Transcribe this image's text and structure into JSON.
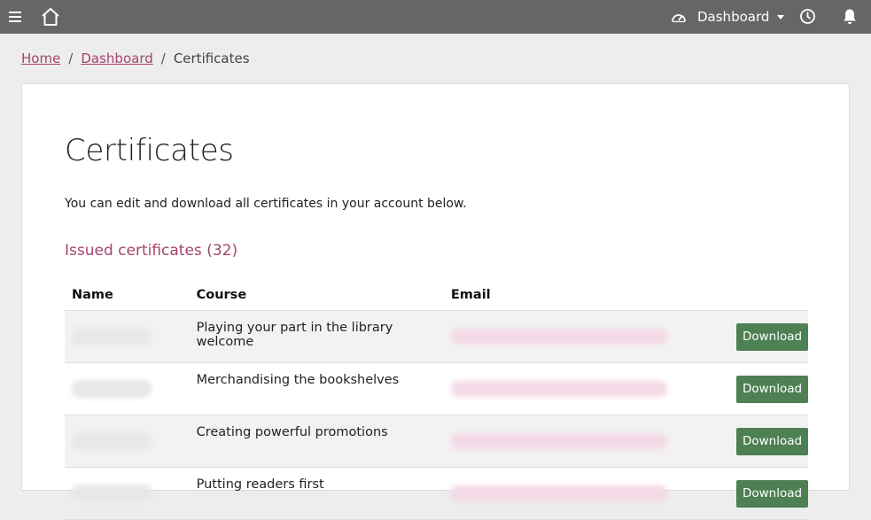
{
  "topbar": {
    "menu_label": "Dashboard",
    "icons": [
      "hamburger-icon",
      "home-icon",
      "speedometer-icon",
      "caret-down-icon",
      "clock-icon",
      "bell-icon"
    ]
  },
  "breadcrumb": {
    "home": "Home",
    "dashboard": "Dashboard",
    "current": "Certificates",
    "separator": "/"
  },
  "page": {
    "title": "Certificates",
    "intro": "You can edit and download all certificates in your account below.",
    "section_heading": "Issued certificates (32)"
  },
  "table": {
    "headers": {
      "name": "Name",
      "course": "Course",
      "email": "Email"
    },
    "rows": [
      {
        "course": "Playing your part in the library welcome",
        "download": "Download"
      },
      {
        "course": "Merchandising the bookshelves",
        "download": "Download"
      },
      {
        "course": "Creating powerful promotions",
        "download": "Download"
      },
      {
        "course": "Putting readers first",
        "download": "Download"
      }
    ]
  },
  "colors": {
    "topbar": "#666666",
    "accent": "#a5446d",
    "download_button": "#4d8053",
    "page_background": "#ededed"
  }
}
